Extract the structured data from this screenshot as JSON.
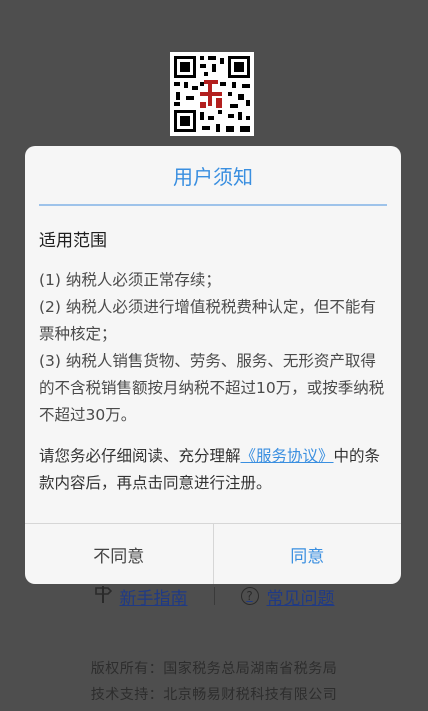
{
  "background": {
    "links": [
      {
        "label": "新手指南",
        "icon": "signpost-icon"
      },
      {
        "label": "常见问题",
        "icon": "question-circle-icon"
      }
    ],
    "footer": {
      "copyright": "版权所有：国家税务总局湖南省税务局",
      "support": "技术支持：北京畅易财税科技有限公司"
    }
  },
  "dialog": {
    "title": "用户须知",
    "section_heading": "适用范围",
    "rules": [
      "(1) 纳税人必须正常存续；",
      "(2) 纳税人必须进行增值税税费种认定，但不能有票种核定；",
      "(3) 纳税人销售货物、劳务、服务、无形资产取得的不含税销售额按月纳税不超过10万，或按季纳税不超过30万。"
    ],
    "notice": {
      "before": "请您务必仔细阅读、充分理解",
      "link": "《服务协议》",
      "after": "中的条款内容后，再点击同意进行注册。"
    },
    "buttons": {
      "cancel": "不同意",
      "agree": "同意"
    }
  },
  "colors": {
    "accent": "#3a8fe0",
    "overlay_background": "#4e4e4e",
    "dialog_background": "#f6f6f6"
  }
}
